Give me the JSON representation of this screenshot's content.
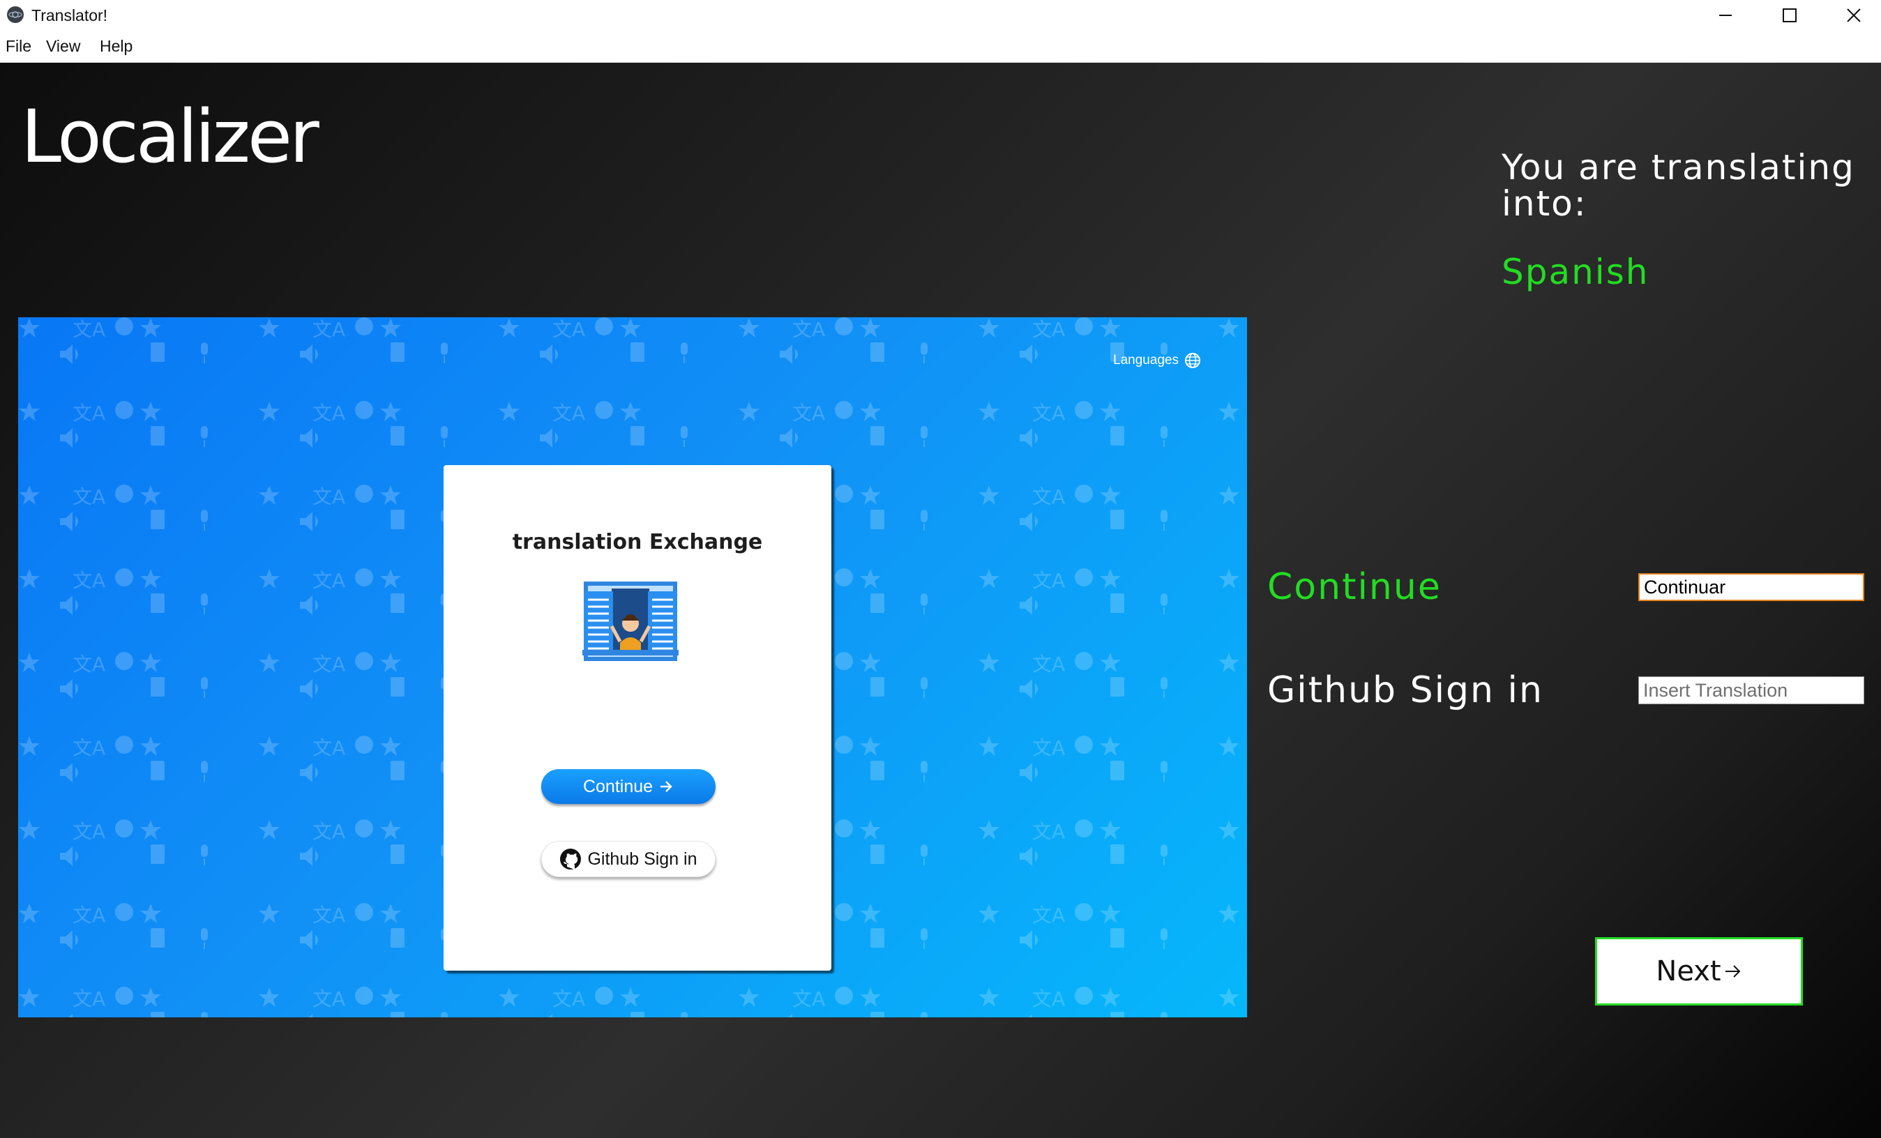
{
  "window": {
    "title": "Translator!",
    "icon": "app-icon",
    "controls": [
      "minimize-icon",
      "maximize-icon",
      "close-icon"
    ]
  },
  "menu": {
    "file": "File",
    "view": "View",
    "help": "Help"
  },
  "app": {
    "logo": "Localizer",
    "translating_label": "You are translating into:",
    "target_language": "Spanish"
  },
  "preview": {
    "languages_link": "Languages",
    "card_title": "translation Exchange",
    "continue_button": "Continue",
    "github_button": "Github Sign in"
  },
  "strings": [
    {
      "source": "Continue",
      "value": "Continuar",
      "placeholder": "Insert Translation"
    },
    {
      "source": "Github Sign in",
      "value": "",
      "placeholder": "Insert Translation"
    }
  ],
  "next_button": "Next",
  "colors": {
    "accent_green": "#22dd22",
    "active_input_border": "#e8821e",
    "preview_blue": "#0877f5"
  }
}
